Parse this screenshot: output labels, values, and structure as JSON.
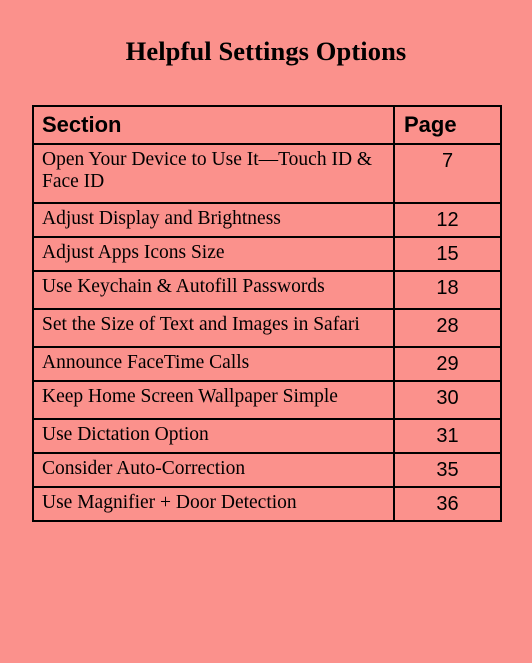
{
  "page": {
    "background_color": "#fb918c",
    "text_color": "#000000",
    "border_color": "#000000",
    "title": "Helpful Settings Options"
  },
  "table": {
    "columns": [
      {
        "key": "section",
        "header": "Section"
      },
      {
        "key": "page",
        "header": "Page"
      }
    ],
    "rows": [
      {
        "section": "Open Your Device to Use It—Touch ID & Face ID",
        "page": "7",
        "lines": 2
      },
      {
        "section": "Adjust Display and Brightness",
        "page": "12",
        "lines": 1
      },
      {
        "section": "Adjust Apps Icons Size",
        "page": "15",
        "lines": 1
      },
      {
        "section": "Use Keychain & Autofill Passwords",
        "page": "18",
        "lines": 2
      },
      {
        "section": "Set the Size of Text and Images in Safari",
        "page": "28",
        "lines": 2
      },
      {
        "section": "Announce FaceTime Calls",
        "page": "29",
        "lines": 1
      },
      {
        "section": "Keep Home Screen Wallpaper Simple",
        "page": "30",
        "lines": 2
      },
      {
        "section": "Use Dictation Option",
        "page": "31",
        "lines": 1
      },
      {
        "section": "Consider Auto-Correction",
        "page": "35",
        "lines": 1
      },
      {
        "section": "Use Magnifier + Door Detection",
        "page": "36",
        "lines": 1
      }
    ]
  }
}
